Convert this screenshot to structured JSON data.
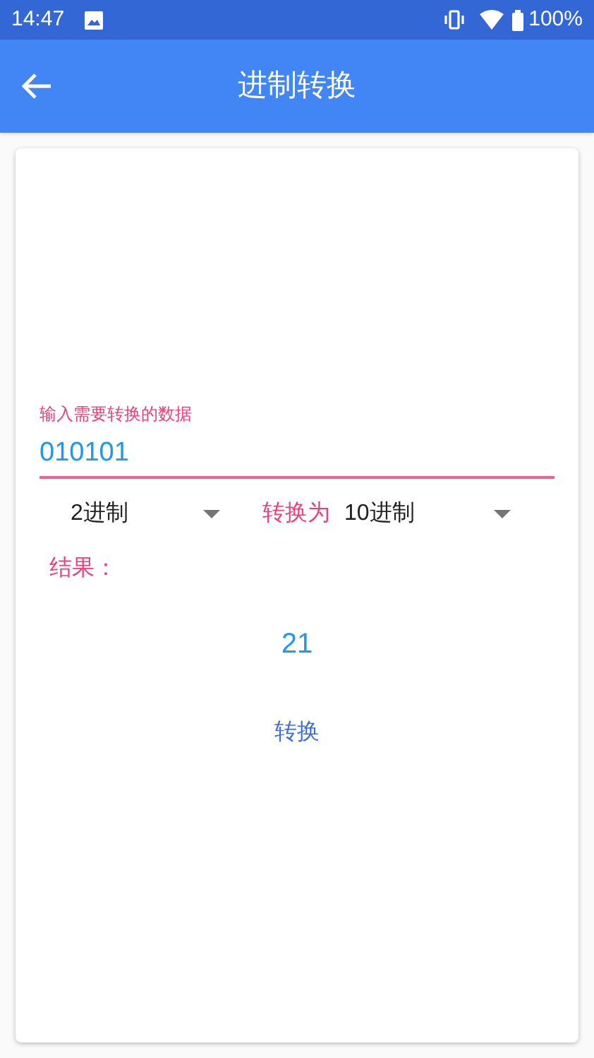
{
  "status_bar": {
    "time": "14:47",
    "battery": "100%"
  },
  "app_bar": {
    "title": "进制转换"
  },
  "input": {
    "label": "输入需要转换的数据",
    "value": "010101"
  },
  "from_spinner": {
    "value": "2进制"
  },
  "to_label": "转换为",
  "to_spinner": {
    "value": "10进制"
  },
  "result_label": "结果：",
  "result": "21",
  "convert_button": "转换"
}
